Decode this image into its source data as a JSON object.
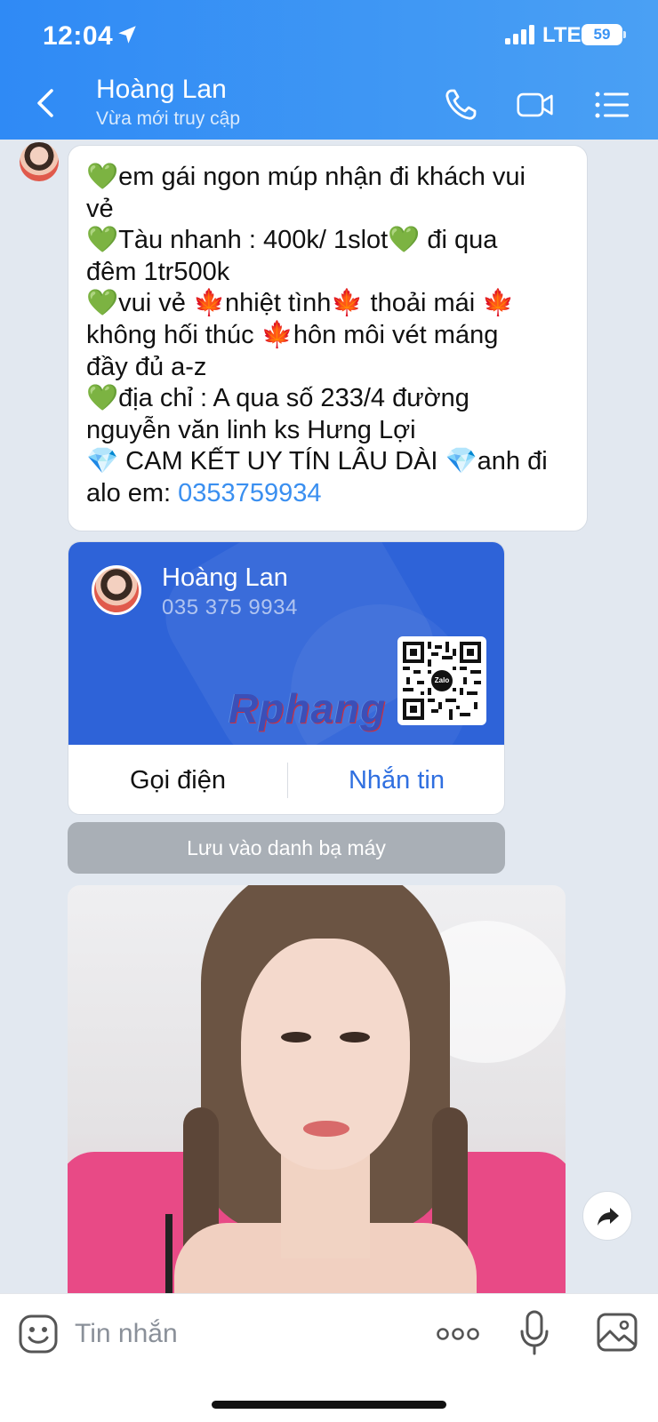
{
  "status_bar": {
    "time": "12:04",
    "network": "LTE",
    "battery": "59"
  },
  "header": {
    "title": "Hoàng Lan",
    "subtitle": "Vừa mới truy cập"
  },
  "message": {
    "lines": [
      {
        "emoji1": "💚",
        "text": "em gái ngon múp nhận đi khách vui"
      },
      {
        "text": "vẻ"
      },
      {
        "emoji1": "💚",
        "text": "Tàu nhanh : 400k/ 1slot",
        "emoji2": "💚",
        "text2": " đi qua"
      },
      {
        "text": "đêm 1tr500k"
      },
      {
        "emoji1": "💚",
        "text": "vui vẻ ",
        "emoji2": "🍁",
        "text2": "nhiệt tình",
        "emoji3": "🍁",
        "text3": " thoải mái ",
        "emoji4": "🍁"
      },
      {
        "text": "không hối thúc ",
        "emoji2": "🍁",
        "text2": "hôn môi vét máng"
      },
      {
        "text": "đầy đủ a-z"
      },
      {
        "emoji1": "💚",
        "text": "địa chỉ : A qua số 233/4 đường"
      },
      {
        "text": "nguyễn văn linh ks Hưng Lợi"
      },
      {
        "emoji1": "💎",
        "text": " CAM KẾT UY TÍN LÂU DÀI ",
        "emoji2": "💎",
        "text2": "anh đi"
      },
      {
        "text": "alo em: ",
        "link": "0353759934"
      }
    ]
  },
  "contact_card": {
    "name": "Hoàng Lan",
    "phone": "035 375 9934",
    "qr_logo": "Zalo",
    "watermark": "Rphang",
    "call_label": "Gọi điện",
    "message_label": "Nhắn tin",
    "call_color": "#111111",
    "message_color": "#2f6fe0"
  },
  "save_contact_label": "Lưu vào danh bạ máy",
  "input": {
    "placeholder": "Tin nhắn"
  },
  "colors": {
    "header_start": "#2f8af5",
    "header_end": "#4aa0f4",
    "chat_bg": "#e2e8f0",
    "link": "#3a8ff0",
    "card_bg": "#2e63d8"
  },
  "icons": [
    "location-arrow-icon",
    "signal-icon",
    "battery-icon",
    "back-chevron-icon",
    "phone-icon",
    "video-camera-icon",
    "menu-list-icon",
    "share-arrow-icon",
    "emoji-icon",
    "more-dots-icon",
    "microphone-icon",
    "image-icon"
  ]
}
